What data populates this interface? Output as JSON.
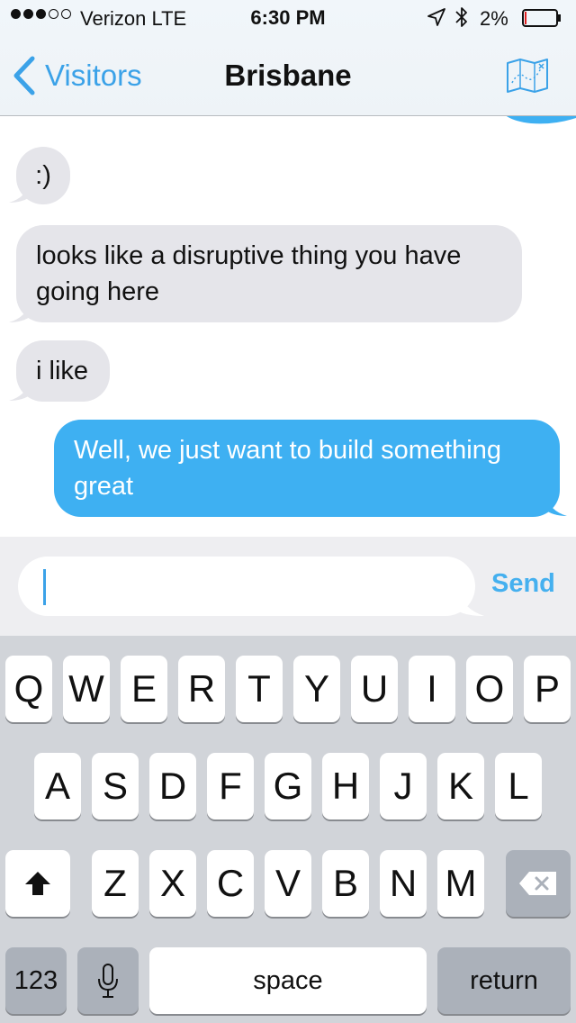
{
  "status": {
    "carrier": "Verizon  LTE",
    "time": "6:30 PM",
    "battery": "2%",
    "signal_bars_filled": 3,
    "signal_bars_total": 5
  },
  "nav": {
    "back_label": "Visitors",
    "title": "Brisbane",
    "map_icon": "map-icon"
  },
  "messages": [
    {
      "direction": "received",
      "text": ":)"
    },
    {
      "direction": "received",
      "text_lines": [
        "looks like a disruptive thing you have",
        "going here"
      ]
    },
    {
      "direction": "received",
      "text": "i like"
    },
    {
      "direction": "sent",
      "text_lines": [
        "Well, we just want to build something",
        "great"
      ]
    }
  ],
  "composer": {
    "value": "",
    "send_label": "Send"
  },
  "keyboard": {
    "row1": [
      "Q",
      "W",
      "E",
      "R",
      "T",
      "Y",
      "U",
      "I",
      "O",
      "P"
    ],
    "row2": [
      "A",
      "S",
      "D",
      "F",
      "G",
      "H",
      "J",
      "K",
      "L"
    ],
    "row3": [
      "Z",
      "X",
      "C",
      "V",
      "B",
      "N",
      "M"
    ],
    "numbers_label": "123",
    "space_label": "space",
    "return_label": "return",
    "shift_icon": "shift-icon",
    "delete_icon": "delete-icon",
    "mic_icon": "microphone-icon"
  },
  "colors": {
    "accent": "#3ba2e8",
    "sent_bubble": "#3eb0f2",
    "received_bubble": "#e5e5ea",
    "battery_low": "#e02020"
  }
}
